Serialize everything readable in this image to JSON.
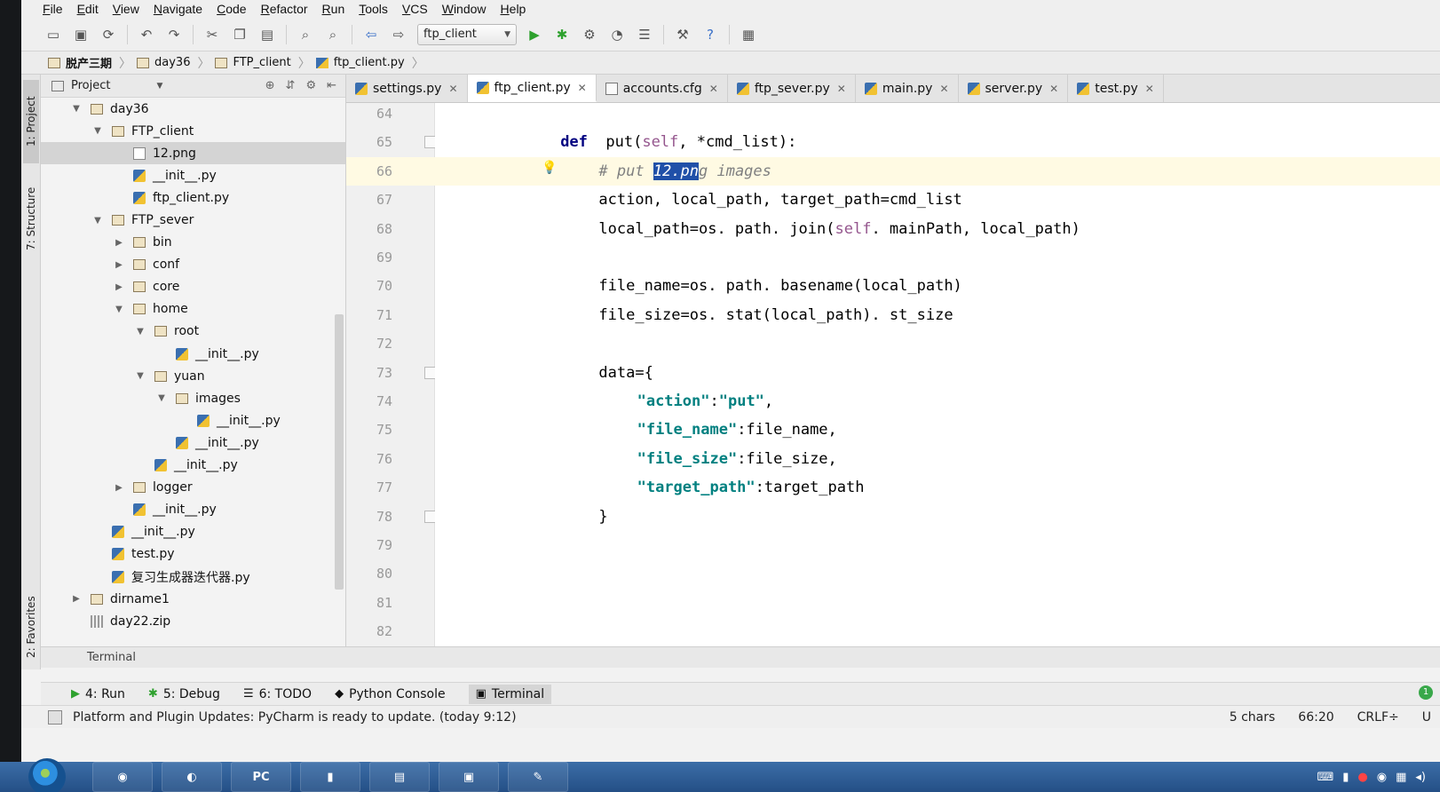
{
  "menu": [
    {
      "u": "F",
      "rest": "ile"
    },
    {
      "u": "E",
      "rest": "dit"
    },
    {
      "u": "V",
      "rest": "iew"
    },
    {
      "u": "N",
      "rest": "avigate"
    },
    {
      "u": "C",
      "rest": "ode"
    },
    {
      "u": "R",
      "rest": "efactor"
    },
    {
      "u": "R",
      "rest": "un"
    },
    {
      "u": "T",
      "rest": "ools"
    },
    {
      "u": "V",
      "rest": "CS"
    },
    {
      "u": "W",
      "rest": "indow"
    },
    {
      "u": "H",
      "rest": "elp"
    }
  ],
  "toolbar": {
    "run_config": "ftp_client"
  },
  "breadcrumb": [
    "脱产三期",
    "day36",
    "FTP_client",
    "ftp_client.py"
  ],
  "sidetools": {
    "project": "1: Project",
    "structure": "7: Structure",
    "favorites": "2: Favorites"
  },
  "project": {
    "title": "Project",
    "tree": [
      {
        "label": "day36",
        "type": "folder",
        "depth": 1,
        "twisty": "▼"
      },
      {
        "label": "FTP_client",
        "type": "folder",
        "depth": 2,
        "twisty": "▼"
      },
      {
        "label": "12.png",
        "type": "img",
        "depth": 3,
        "twisty": "",
        "selected": true
      },
      {
        "label": "__init__.py",
        "type": "py",
        "depth": 3,
        "twisty": ""
      },
      {
        "label": "ftp_client.py",
        "type": "py",
        "depth": 3,
        "twisty": ""
      },
      {
        "label": "FTP_sever",
        "type": "folder",
        "depth": 2,
        "twisty": "▼"
      },
      {
        "label": "bin",
        "type": "folder",
        "depth": 3,
        "twisty": "▶"
      },
      {
        "label": "conf",
        "type": "folder",
        "depth": 3,
        "twisty": "▶"
      },
      {
        "label": "core",
        "type": "folder",
        "depth": 3,
        "twisty": "▶"
      },
      {
        "label": "home",
        "type": "folder",
        "depth": 3,
        "twisty": "▼"
      },
      {
        "label": "root",
        "type": "folder",
        "depth": 4,
        "twisty": "▼"
      },
      {
        "label": "__init__.py",
        "type": "py",
        "depth": 5,
        "twisty": ""
      },
      {
        "label": "yuan",
        "type": "folder",
        "depth": 4,
        "twisty": "▼"
      },
      {
        "label": "images",
        "type": "folder",
        "depth": 5,
        "twisty": "▼"
      },
      {
        "label": "__init__.py",
        "type": "py",
        "depth": 6,
        "twisty": ""
      },
      {
        "label": "__init__.py",
        "type": "py",
        "depth": 5,
        "twisty": ""
      },
      {
        "label": "__init__.py",
        "type": "py",
        "depth": 4,
        "twisty": ""
      },
      {
        "label": "logger",
        "type": "folder",
        "depth": 3,
        "twisty": "▶"
      },
      {
        "label": "__init__.py",
        "type": "py",
        "depth": 3,
        "twisty": ""
      },
      {
        "label": "__init__.py",
        "type": "py",
        "depth": 2,
        "twisty": ""
      },
      {
        "label": "test.py",
        "type": "py",
        "depth": 2,
        "twisty": ""
      },
      {
        "label": "复习生成器迭代器.py",
        "type": "py",
        "depth": 2,
        "twisty": ""
      },
      {
        "label": "dirname1",
        "type": "folder",
        "depth": 1,
        "twisty": "▶"
      },
      {
        "label": "day22.zip",
        "type": "zip",
        "depth": 1,
        "twisty": ""
      }
    ]
  },
  "editor": {
    "tabs": [
      {
        "label": "settings.py",
        "type": "py"
      },
      {
        "label": "ftp_client.py",
        "type": "py",
        "active": true
      },
      {
        "label": "accounts.cfg",
        "type": "cfg"
      },
      {
        "label": "ftp_sever.py",
        "type": "py"
      },
      {
        "label": "main.py",
        "type": "py"
      },
      {
        "label": "server.py",
        "type": "py"
      },
      {
        "label": "test.py",
        "type": "py"
      }
    ],
    "lines": [
      {
        "n": "64",
        "indent": 0,
        "parts": []
      },
      {
        "n": "65",
        "indent": 4,
        "parts": [
          [
            "kw",
            "def"
          ],
          [
            "",
            "  put("
          ],
          [
            "slf",
            "self"
          ],
          [
            "",
            ", *cmd_list):"
          ]
        ]
      },
      {
        "n": "66",
        "indent": 8,
        "current": true,
        "parts": [
          [
            "cmt",
            "# put "
          ],
          [
            "cmt hl",
            "12.pn"
          ],
          [
            "cmt",
            "g images"
          ]
        ]
      },
      {
        "n": "67",
        "indent": 8,
        "parts": [
          [
            "",
            "action, local_path, target_path=cmd_list"
          ]
        ]
      },
      {
        "n": "68",
        "indent": 8,
        "parts": [
          [
            "",
            "local_path=os. path. join("
          ],
          [
            "slf",
            "self"
          ],
          [
            "",
            ". mainPath, local_path)"
          ]
        ]
      },
      {
        "n": "69",
        "indent": 0,
        "parts": []
      },
      {
        "n": "70",
        "indent": 8,
        "parts": [
          [
            "",
            "file_name=os. path. basename(local_path)"
          ]
        ]
      },
      {
        "n": "71",
        "indent": 8,
        "parts": [
          [
            "",
            "file_size=os. stat(local_path). st_size"
          ]
        ]
      },
      {
        "n": "72",
        "indent": 0,
        "parts": []
      },
      {
        "n": "73",
        "indent": 8,
        "parts": [
          [
            "",
            "data={"
          ]
        ]
      },
      {
        "n": "74",
        "indent": 12,
        "parts": [
          [
            "str",
            "\"action\""
          ],
          [
            "",
            ":"
          ],
          [
            "str",
            "\"put\""
          ],
          [
            "",
            ","
          ]
        ]
      },
      {
        "n": "75",
        "indent": 12,
        "parts": [
          [
            "str",
            "\"file_name\""
          ],
          [
            "",
            ":file_name,"
          ]
        ]
      },
      {
        "n": "76",
        "indent": 12,
        "parts": [
          [
            "str",
            "\"file_size\""
          ],
          [
            "",
            ":file_size,"
          ]
        ]
      },
      {
        "n": "77",
        "indent": 12,
        "parts": [
          [
            "str",
            "\"target_path\""
          ],
          [
            "",
            ":target_path"
          ]
        ]
      },
      {
        "n": "78",
        "indent": 8,
        "parts": [
          [
            "",
            "}"
          ]
        ]
      },
      {
        "n": "79",
        "indent": 0,
        "parts": []
      },
      {
        "n": "80",
        "indent": 0,
        "parts": []
      },
      {
        "n": "81",
        "indent": 0,
        "parts": []
      },
      {
        "n": "82",
        "indent": 0,
        "parts": []
      }
    ]
  },
  "terminal_label": "Terminal",
  "tool_tabs": [
    {
      "icon": "▶",
      "label": "4: Run"
    },
    {
      "icon": "✱",
      "label": "5: Debug"
    },
    {
      "icon": "☰",
      "label": "6: TODO"
    },
    {
      "icon": "◆",
      "label": "Python Console"
    },
    {
      "icon": "▣",
      "label": "Terminal",
      "active": true
    }
  ],
  "status": {
    "message": "Platform and Plugin Updates: PyCharm is ready to update. (today 9:12)",
    "chars": "5 chars",
    "position": "66:20",
    "line_sep": "CRLF÷",
    "encoding": "U"
  },
  "notification_count": "1"
}
